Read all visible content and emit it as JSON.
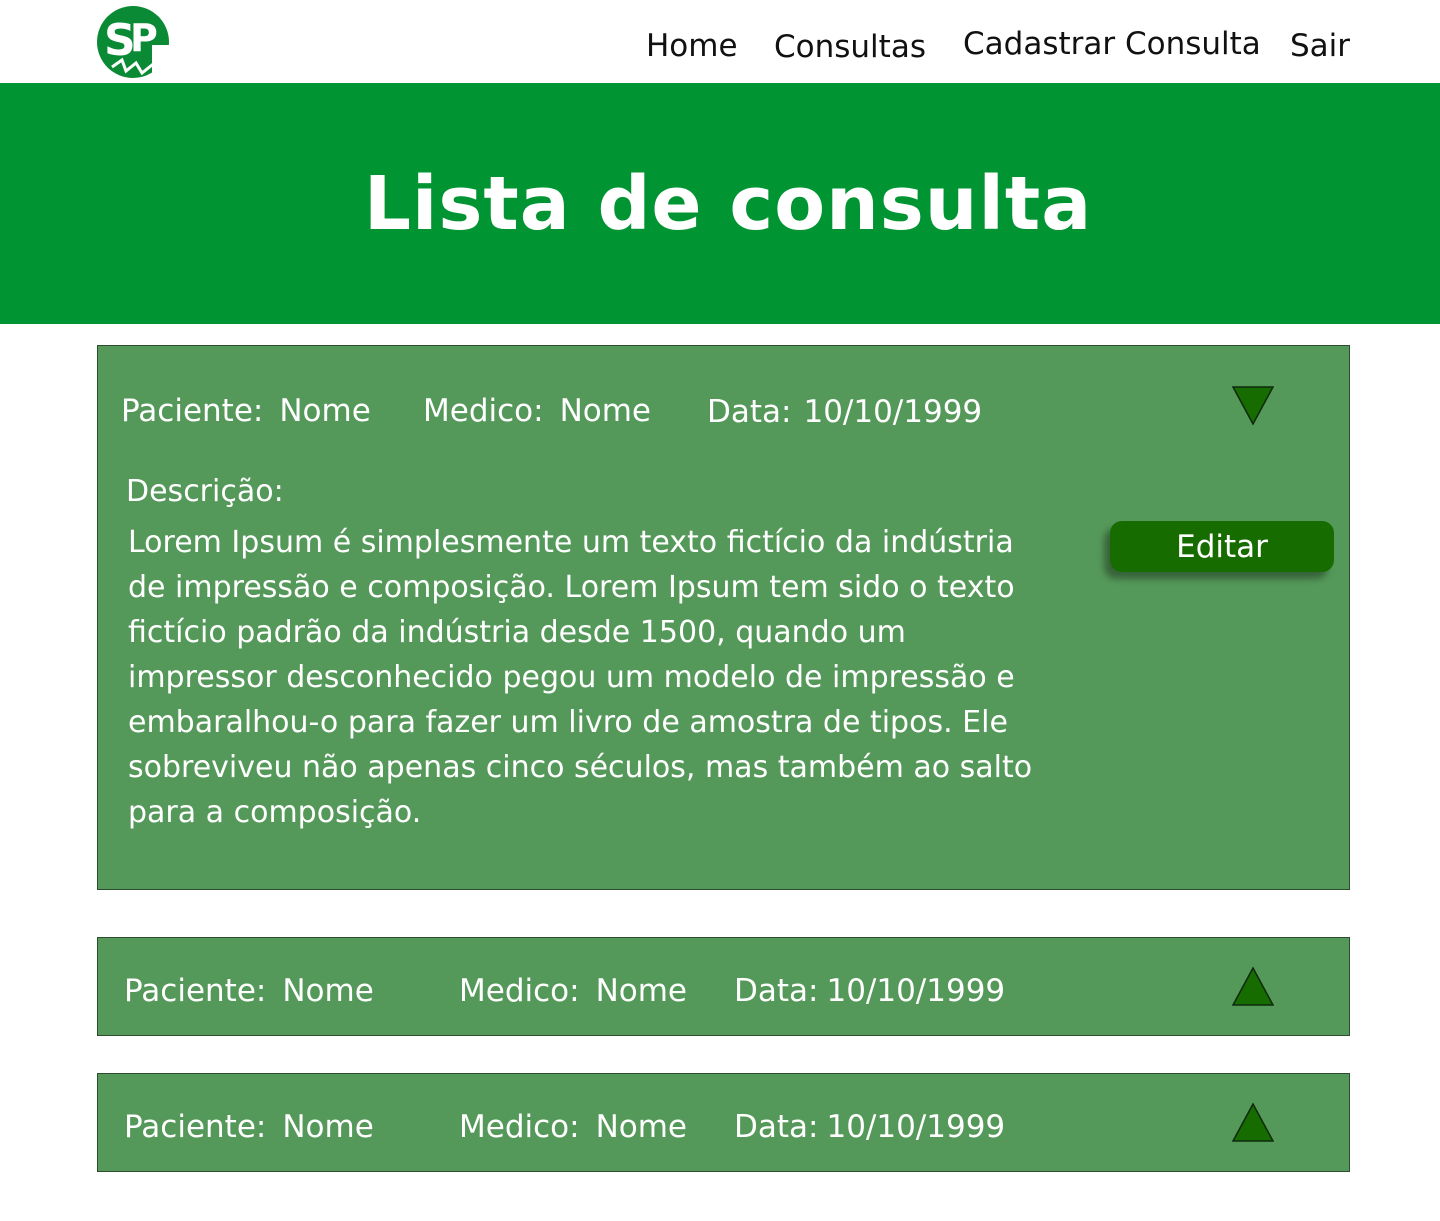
{
  "nav": {
    "logo_alt": "SP",
    "items": [
      {
        "label": "Home"
      },
      {
        "label": "Consultas"
      },
      {
        "label": "Cadastrar Consulta"
      },
      {
        "label": "Sair"
      }
    ]
  },
  "hero": {
    "title": "Lista de consulta"
  },
  "colors": {
    "brand_green": "#009432",
    "card_green": "#55995a",
    "button_green": "#176c00",
    "arrow_green": "#176c00"
  },
  "consultas": [
    {
      "paciente_label": "Paciente:",
      "paciente": "Nome",
      "medico_label": "Medico:",
      "medico": "Nome",
      "data_label": "Data:",
      "data": "10/10/1999",
      "expanded": true,
      "toggle_icon": "triangle-down-icon",
      "descricao_label": "Descrição:",
      "descricao": "Lorem Ipsum é simplesmente um texto fictício da indústria de impressão e composição. Lorem Ipsum tem sido o texto fictício padrão da indústria desde 1500, quando um impressor desconhecido pegou um modelo de impressão e embaralhou-o para fazer um livro de amostra de tipos. Ele sobreviveu não apenas cinco séculos, mas também ao salto para a composição.",
      "edit_label": "Editar"
    },
    {
      "paciente_label": "Paciente:",
      "paciente": "Nome",
      "medico_label": "Medico:",
      "medico": "Nome",
      "data_label": "Data:",
      "data": "10/10/1999",
      "expanded": false,
      "toggle_icon": "triangle-up-icon"
    },
    {
      "paciente_label": "Paciente:",
      "paciente": "Nome",
      "medico_label": "Medico:",
      "medico": "Nome",
      "data_label": "Data:",
      "data": "10/10/1999",
      "expanded": false,
      "toggle_icon": "triangle-up-icon"
    }
  ]
}
